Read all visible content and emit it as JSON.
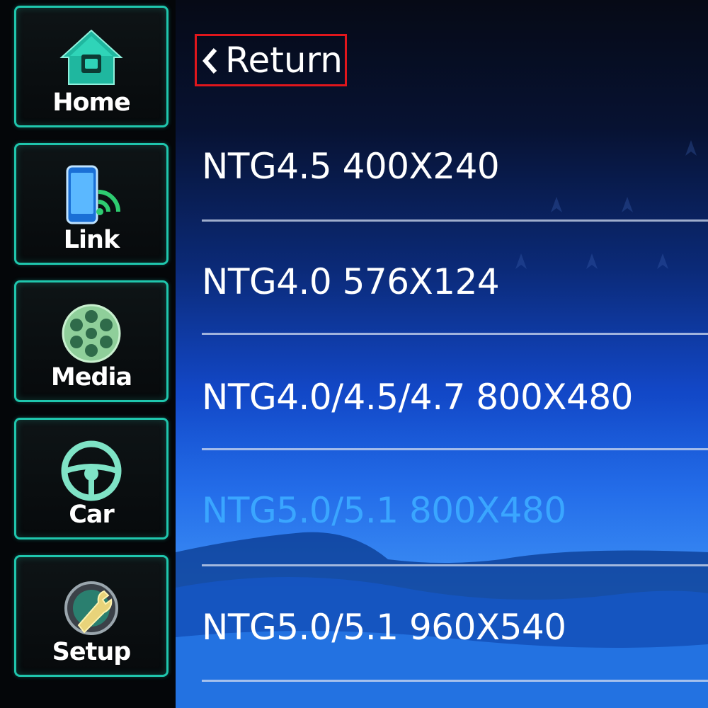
{
  "sidebar": {
    "items": [
      {
        "label": "Home",
        "icon": "home-icon"
      },
      {
        "label": "Link",
        "icon": "phone-link-icon"
      },
      {
        "label": "Media",
        "icon": "film-reel-icon"
      },
      {
        "label": "Car",
        "icon": "steering-wheel-icon"
      },
      {
        "label": "Setup",
        "icon": "gear-wrench-icon"
      }
    ]
  },
  "main": {
    "return_label": "Return",
    "resolutions": [
      {
        "label": "NTG4.5 400X240",
        "selected": false
      },
      {
        "label": "NTG4.0 576X124",
        "selected": false
      },
      {
        "label": "NTG4.0/4.5/4.7 800X480",
        "selected": false
      },
      {
        "label": "NTG5.0/5.1 800X480",
        "selected": true
      },
      {
        "label": "NTG5.0/5.1 960X540",
        "selected": false
      }
    ]
  },
  "colors": {
    "accent": "#1fc6ad",
    "selected_text": "#3aa6ff",
    "return_border": "#e0161c"
  }
}
